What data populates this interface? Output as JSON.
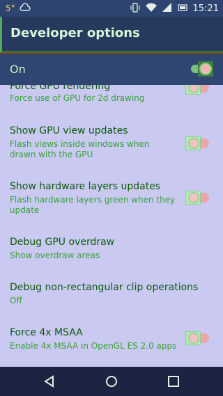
{
  "status_bar": {
    "temperature": "5°",
    "time": "15:21",
    "icons": [
      "cloud-icon",
      "vibrate-icon",
      "wifi-icon",
      "cell-signal-icon",
      "battery-icon"
    ]
  },
  "toolbar": {
    "title": "Developer options"
  },
  "master": {
    "label": "On",
    "enabled": true
  },
  "items": [
    {
      "title": "Force GPU rendering",
      "summary": "Force use of GPU for 2d drawing",
      "toggle": true
    },
    {
      "title": "Show GPU view updates",
      "summary": "Flash views inside windows when drawn with the GPU",
      "toggle": true
    },
    {
      "title": "Show hardware layers updates",
      "summary": "Flash hardware layers green when they update",
      "toggle": true
    },
    {
      "title": "Debug GPU overdraw",
      "summary": "Show overdraw areas",
      "toggle": false
    },
    {
      "title": "Debug non-rectangular clip operations",
      "summary": "Off",
      "toggle": false
    },
    {
      "title": "Force 4x MSAA",
      "summary": "Enable 4x MSAA in OpenGL ES 2.0 apps",
      "toggle": true
    }
  ],
  "nav": [
    "back-icon",
    "home-icon",
    "recents-icon"
  ],
  "colors": {
    "toolbar": "#273a5e",
    "background": "#c9c9f1",
    "title_text": "#0e5a0e",
    "summary_text": "#3aa23a"
  }
}
